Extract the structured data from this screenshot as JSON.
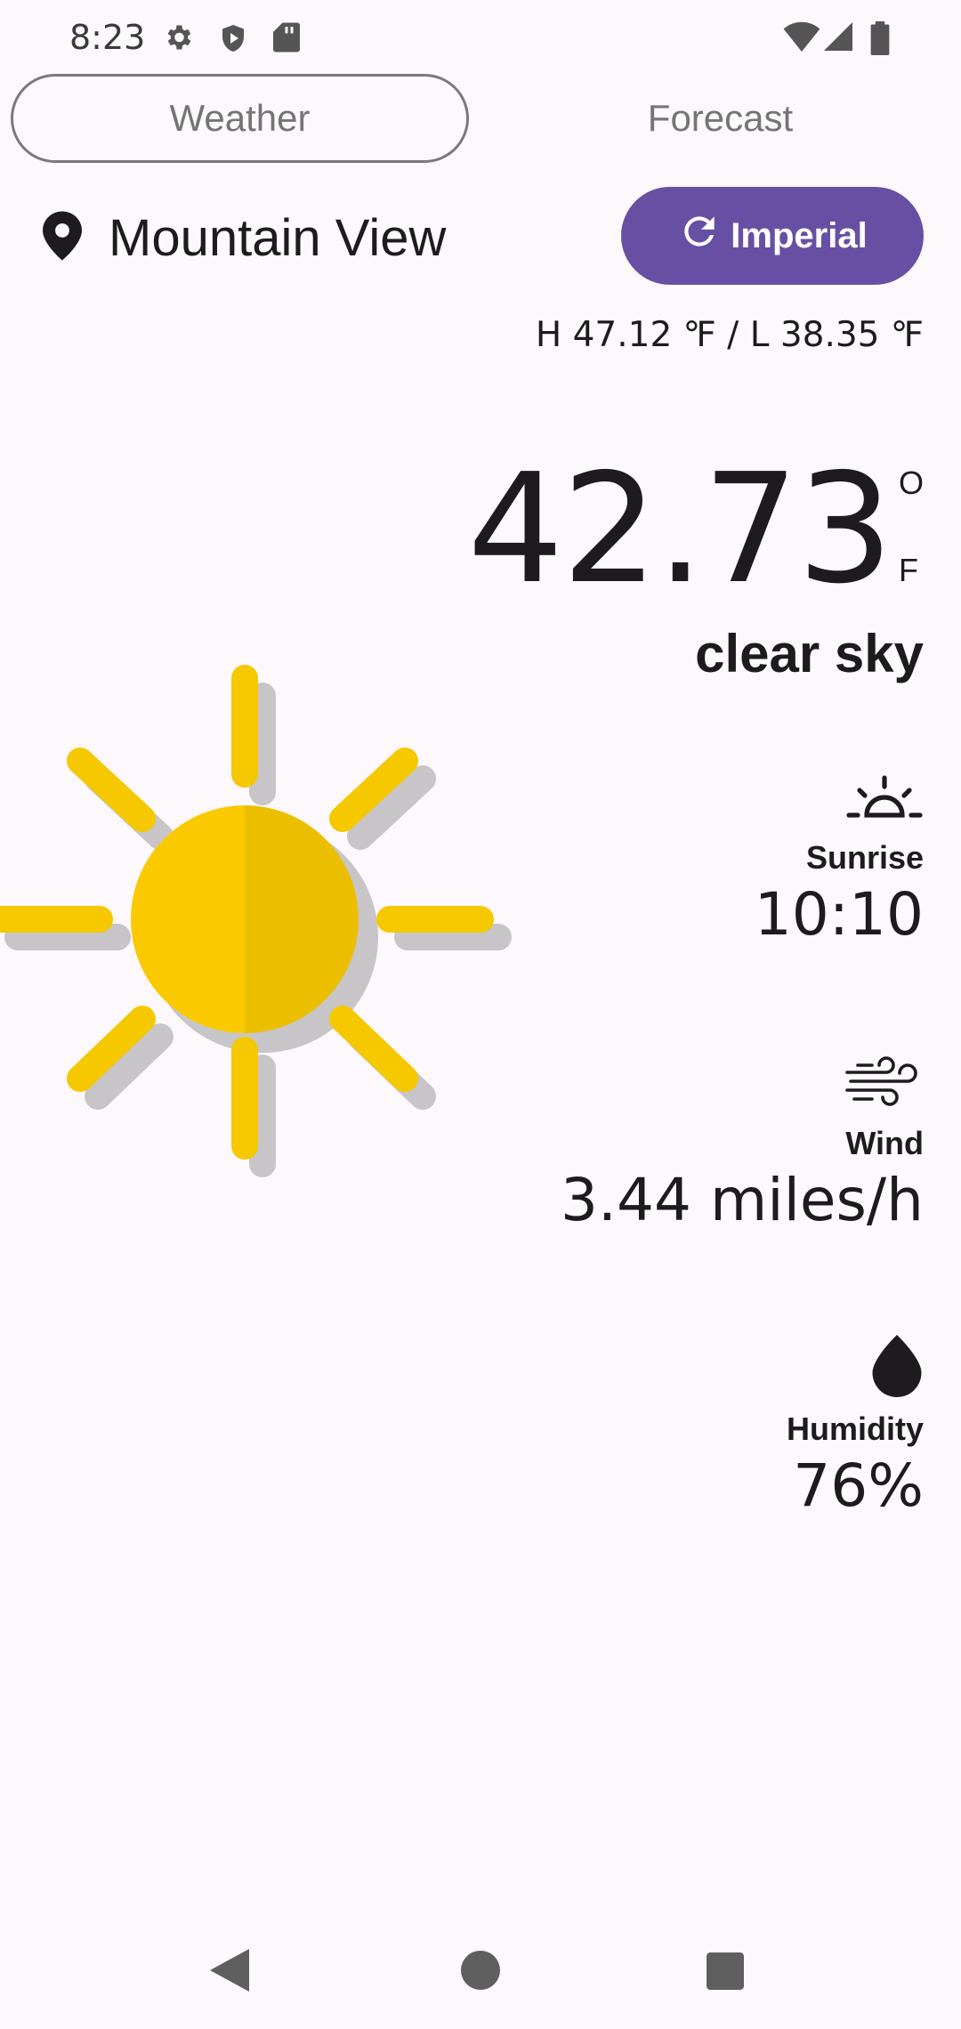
{
  "status_bar": {
    "time": "8:23",
    "left_icons": [
      "gear-icon",
      "shield-icon",
      "sd-card-icon"
    ],
    "right_icons": [
      "wifi-icon",
      "signal-icon",
      "battery-icon"
    ]
  },
  "tabs": [
    {
      "label": "Weather",
      "selected": true
    },
    {
      "label": "Forecast",
      "selected": false
    }
  ],
  "location": {
    "name": "Mountain View",
    "icon": "location-pin-icon"
  },
  "units_button": {
    "label": "Imperial",
    "icon": "refresh-icon",
    "color": "#6750a4"
  },
  "high_low": "H 47.12 ℉ / L 38.35 ℉",
  "temperature": {
    "value": "42.73",
    "degree_symbol": "O",
    "unit": "F"
  },
  "condition": "clear sky",
  "weather_icon": "sun-icon",
  "details": {
    "sunrise": {
      "label": "Sunrise",
      "value": "10:10",
      "icon": "sunrise-icon"
    },
    "wind": {
      "label": "Wind",
      "value": "3.44 miles/h",
      "icon": "wind-icon"
    },
    "humidity": {
      "label": "Humidity",
      "value": "76%",
      "icon": "water-drop-icon"
    }
  },
  "nav_bar": {
    "buttons": [
      "back-icon",
      "home-icon",
      "recents-icon"
    ]
  },
  "colors": {
    "accent": "#6750a4",
    "sun": "#fbc900",
    "sun_shade": "#ebbf00",
    "background": "#fdf8fb"
  }
}
